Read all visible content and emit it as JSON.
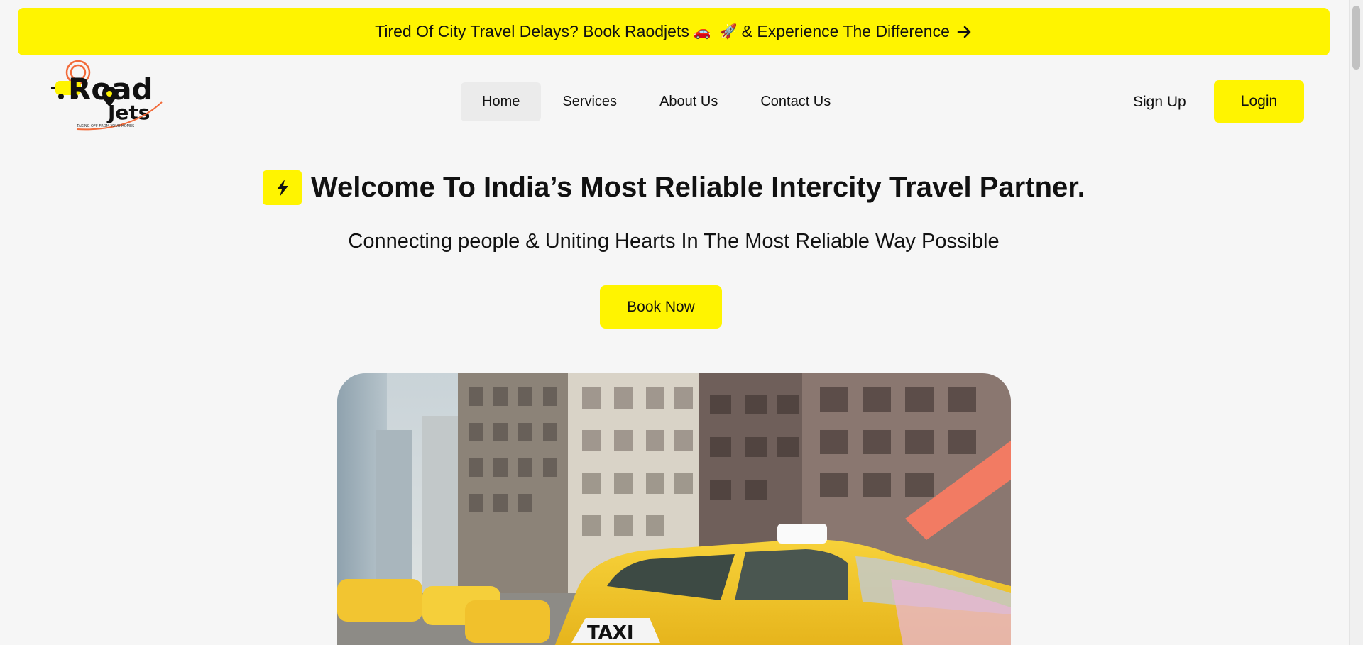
{
  "announcement": {
    "text_before": "Tired Of City Travel Delays? Book Raodjets",
    "emoji_car": "🚗",
    "emoji_rocket": "🚀",
    "text_after": "& Experience The Difference",
    "arrow_icon": "arrow-right-icon"
  },
  "logo": {
    "brand_line1": "Road",
    "brand_line2": "Jets",
    "tagline": "TAKING OFF FROM YOUR HOMES"
  },
  "nav": {
    "items": [
      {
        "label": "Home",
        "active": true
      },
      {
        "label": "Services",
        "active": false
      },
      {
        "label": "About Us",
        "active": false
      },
      {
        "label": "Contact Us",
        "active": false
      }
    ]
  },
  "auth": {
    "signup_label": "Sign Up",
    "login_label": "Login"
  },
  "hero": {
    "title": "Welcome To India’s Most Reliable Intercity Travel Partner.",
    "title_icon": "lightning-bolt-icon",
    "subtitle": "Connecting people & Uniting Hearts In The Most Reliable Way Possible",
    "cta_label": "Book Now",
    "image_taxi_label": "TAXI"
  },
  "colors": {
    "accent": "#fff400",
    "background": "#f6f6f6",
    "text": "#111111",
    "nav_active_bg": "#ebebeb"
  }
}
